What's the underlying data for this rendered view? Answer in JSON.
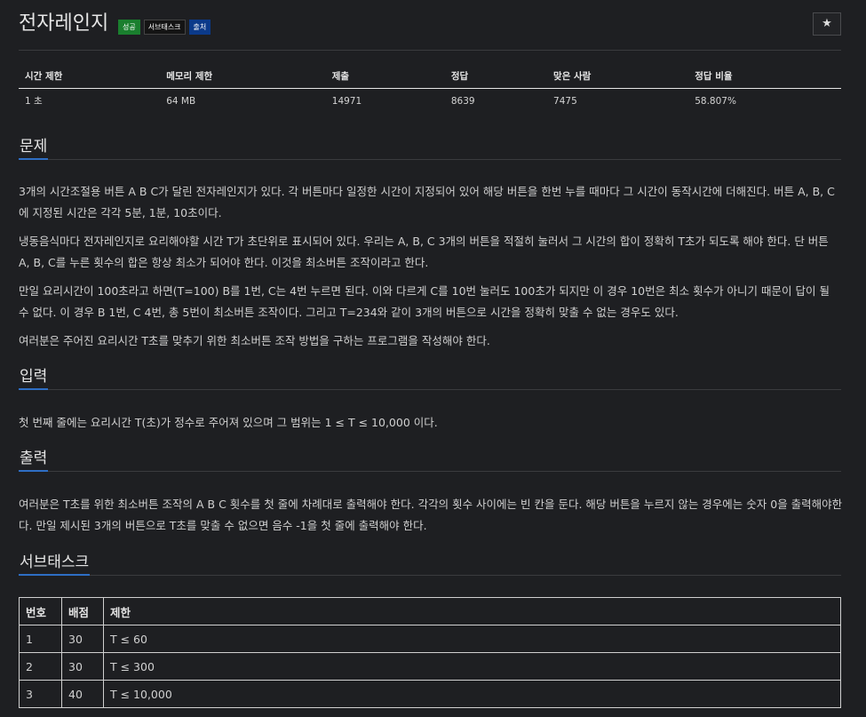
{
  "problem": {
    "title": "전자레인지",
    "badges": [
      "성공",
      "서브태스크",
      "출처"
    ],
    "star_icon": "★"
  },
  "info_table": {
    "headers": [
      "시간 제한",
      "메모리 제한",
      "제출",
      "정답",
      "맞은 사람",
      "정답 비율"
    ],
    "values": [
      "1 초",
      "64 MB",
      "14971",
      "8639",
      "7475",
      "58.807%"
    ]
  },
  "sections": {
    "problem": {
      "heading": "문제",
      "paragraphs": [
        "3개의 시간조절용 버튼 A B C가 달린 전자레인지가 있다. 각 버튼마다 일정한 시간이 지정되어 있어 해당 버튼을 한번 누를 때마다 그 시간이 동작시간에 더해진다. 버튼 A, B, C에 지정된 시간은 각각 5분, 1분, 10초이다.",
        "냉동음식마다 전자레인지로 요리해야할 시간 T가 초단위로 표시되어 있다. 우리는 A, B, C 3개의 버튼을 적절히 눌러서 그 시간의 합이 정확히 T초가 되도록 해야 한다. 단 버튼 A, B, C를 누른 횟수의 합은 항상 최소가 되어야 한다. 이것을 최소버튼 조작이라고 한다.",
        "만일 요리시간이 100초라고 하면(T=100) B를 1번, C는 4번 누르면 된다. 이와 다르게 C를 10번 눌러도 100초가 되지만 이 경우 10번은 최소 횟수가 아니기 때문이 답이 될 수 없다. 이 경우 B 1번, C 4번, 총 5번이 최소버튼 조작이다. 그리고 T=234와 같이 3개의 버튼으로 시간을 정확히 맞출 수 없는 경우도 있다.",
        "여러분은 주어진 요리시간 T초를 맞추기 위한 최소버튼 조작 방법을 구하는 프로그램을 작성해야 한다."
      ]
    },
    "input": {
      "heading": "입력",
      "paragraph": "첫 번째 줄에는 요리시간 T(초)가 정수로 주어져 있으며 그 범위는 1 ≤ T ≤ 10,000 이다."
    },
    "output": {
      "heading": "출력",
      "paragraph": "여러분은 T초를 위한 최소버튼 조작의 A B C 횟수를 첫 줄에 차례대로 출력해야 한다. 각각의 횟수 사이에는 빈 칸을 둔다. 해당 버튼을 누르지 않는 경우에는 숫자 0을 출력해야한다. 만일 제시된 3개의 버튼으로 T초를 맞출 수 없으면 음수 -1을 첫 줄에 출력해야 한다."
    },
    "subtask": {
      "heading": "서브태스크",
      "headers": [
        "번호",
        "배점",
        "제한"
      ],
      "rows": [
        [
          "1",
          "30",
          "T ≤ 60"
        ],
        [
          "2",
          "30",
          "T ≤ 300"
        ],
        [
          "3",
          "40",
          "T ≤ 10,000"
        ]
      ]
    }
  },
  "colors": {
    "background": "#1e1f22",
    "accent_underline": "#2e6ec4",
    "badge_success": "#1a7f2e",
    "badge_subtask": "#141414",
    "badge_source": "#0b3a8a"
  }
}
